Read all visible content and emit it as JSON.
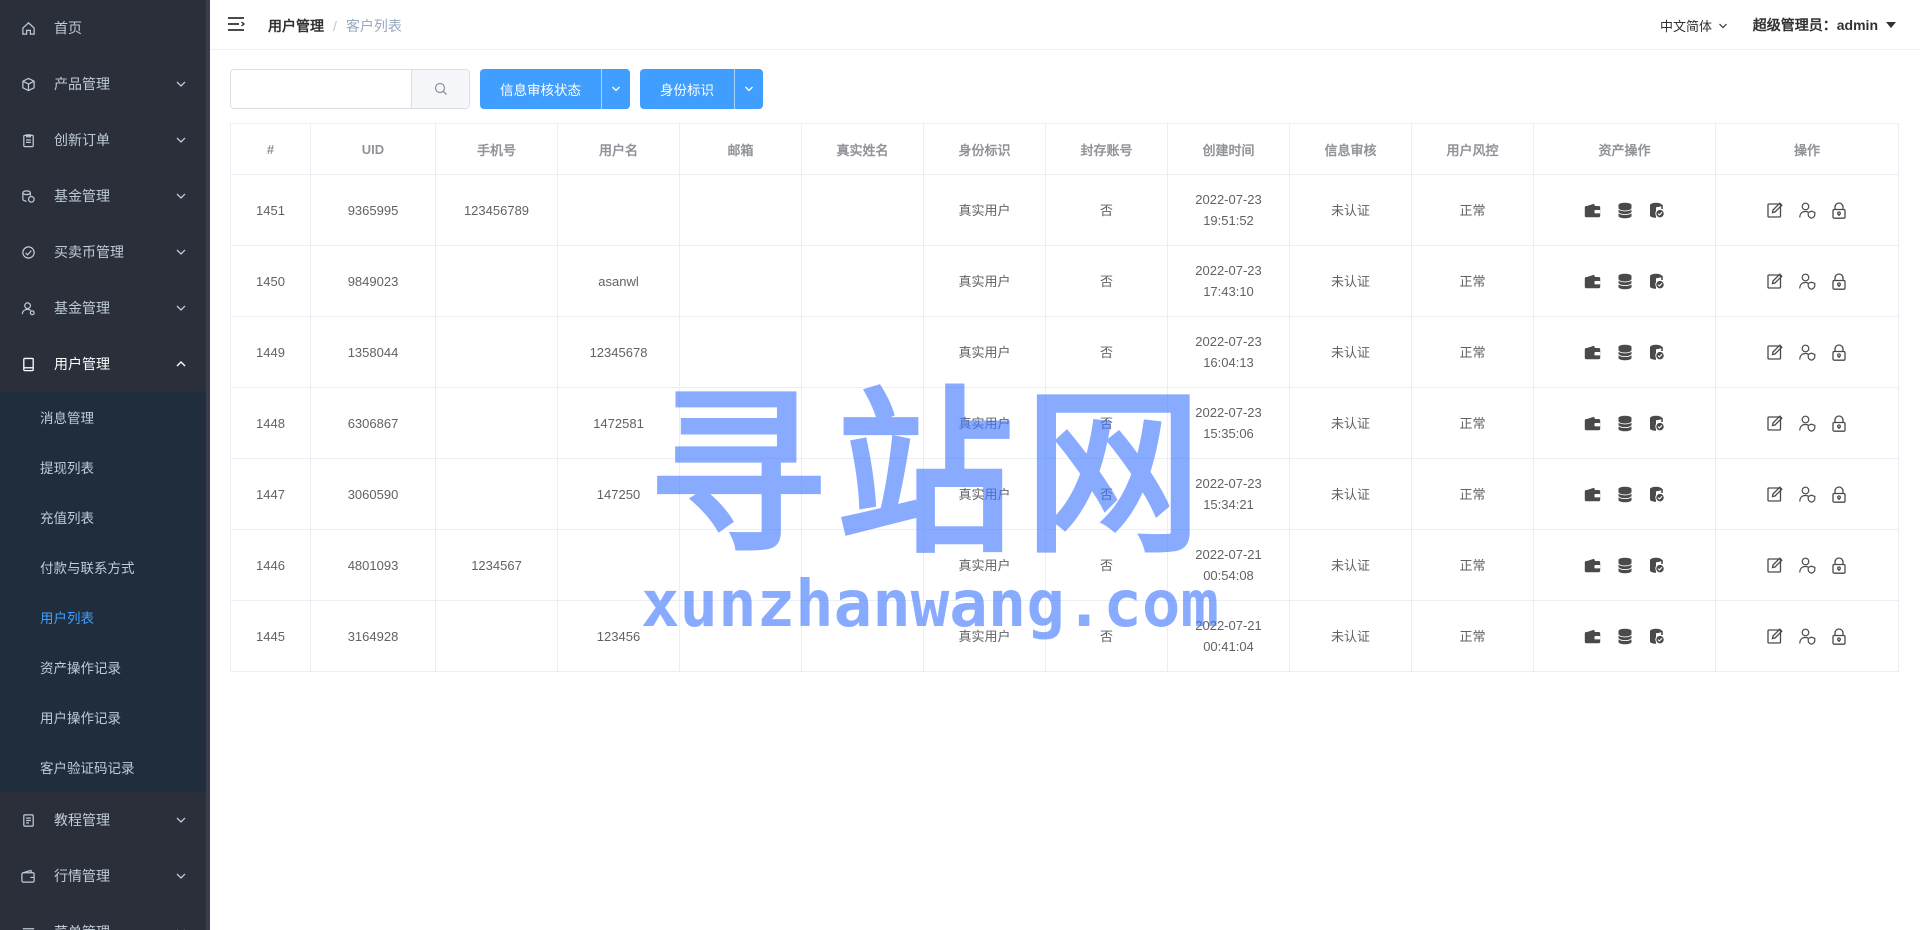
{
  "sidebar": {
    "items": [
      {
        "label": "首页",
        "icon": "home-icon"
      },
      {
        "label": "产品管理",
        "icon": "cube-icon"
      },
      {
        "label": "创新订单",
        "icon": "clipboard-icon"
      },
      {
        "label": "基金管理",
        "icon": "coins-icon"
      },
      {
        "label": "买卖币管理",
        "icon": "gauge-icon"
      },
      {
        "label": "基金管理",
        "icon": "user-settings-icon"
      },
      {
        "label": "用户管理",
        "icon": "tablet-icon"
      }
    ],
    "user_submenu": [
      {
        "label": "消息管理"
      },
      {
        "label": "提现列表"
      },
      {
        "label": "充值列表"
      },
      {
        "label": "付款与联系方式"
      },
      {
        "label": "用户列表"
      },
      {
        "label": "资产操作记录"
      },
      {
        "label": "用户操作记录"
      },
      {
        "label": "客户验证码记录"
      }
    ],
    "bottom_items": [
      {
        "label": "教程管理",
        "icon": "document-icon"
      },
      {
        "label": "行情管理",
        "icon": "wallet-icon"
      },
      {
        "label": "菜单管理",
        "icon": "menu-icon"
      }
    ]
  },
  "header": {
    "breadcrumb_main": "用户管理",
    "breadcrumb_sep": "/",
    "breadcrumb_current": "客户列表",
    "language": "中文简体",
    "admin_label": "超级管理员：admin"
  },
  "toolbar": {
    "search_value": "",
    "search_placeholder": "",
    "filter1_label": "信息审核状态",
    "filter2_label": "身份标识"
  },
  "table": {
    "columns": [
      "#",
      "UID",
      "手机号",
      "用户名",
      "邮箱",
      "真实姓名",
      "身份标识",
      "封存账号",
      "创建时间",
      "信息审核",
      "用户风控",
      "资产操作",
      "操作"
    ],
    "rows": [
      {
        "id": "1451",
        "uid": "9365995",
        "phone": "123456789",
        "username": "",
        "email": "",
        "realname": "",
        "identity": "真实用户",
        "frozen": "否",
        "created": "2022-07-23 19:51:52",
        "audit": "未认证",
        "risk": "正常"
      },
      {
        "id": "1450",
        "uid": "9849023",
        "phone": "",
        "username": "asanwl",
        "email": "",
        "realname": "",
        "identity": "真实用户",
        "frozen": "否",
        "created": "2022-07-23 17:43:10",
        "audit": "未认证",
        "risk": "正常"
      },
      {
        "id": "1449",
        "uid": "1358044",
        "phone": "",
        "username": "12345678",
        "email": "",
        "realname": "",
        "identity": "真实用户",
        "frozen": "否",
        "created": "2022-07-23 16:04:13",
        "audit": "未认证",
        "risk": "正常"
      },
      {
        "id": "1448",
        "uid": "6306867",
        "phone": "",
        "username": "1472581",
        "email": "",
        "realname": "",
        "identity": "真实用户",
        "frozen": "否",
        "created": "2022-07-23 15:35:06",
        "audit": "未认证",
        "risk": "正常"
      },
      {
        "id": "1447",
        "uid": "3060590",
        "phone": "",
        "username": "147250",
        "email": "",
        "realname": "",
        "identity": "真实用户",
        "frozen": "否",
        "created": "2022-07-23 15:34:21",
        "audit": "未认证",
        "risk": "正常"
      },
      {
        "id": "1446",
        "uid": "4801093",
        "phone": "1234567",
        "username": "",
        "email": "",
        "realname": "",
        "identity": "真实用户",
        "frozen": "否",
        "created": "2022-07-21 00:54:08",
        "audit": "未认证",
        "risk": "正常"
      },
      {
        "id": "1445",
        "uid": "3164928",
        "phone": "",
        "username": "123456",
        "email": "",
        "realname": "",
        "identity": "真实用户",
        "frozen": "否",
        "created": "2022-07-21 00:41:04",
        "audit": "未认证",
        "risk": "正常"
      }
    ],
    "asset_icons": [
      "wallet-icon",
      "coin-stack-icon",
      "coin-check-icon"
    ],
    "action_icons": [
      "edit-icon",
      "user-shield-icon",
      "lock-icon"
    ]
  },
  "watermark": {
    "main": "寻站网",
    "sub": "xunzhanwang.com"
  },
  "colors": {
    "sidebar_bg": "#2b2f3a",
    "submenu_bg": "#1f2d3d",
    "accent": "#409eff",
    "icon_dark": "#4a4a4a"
  }
}
